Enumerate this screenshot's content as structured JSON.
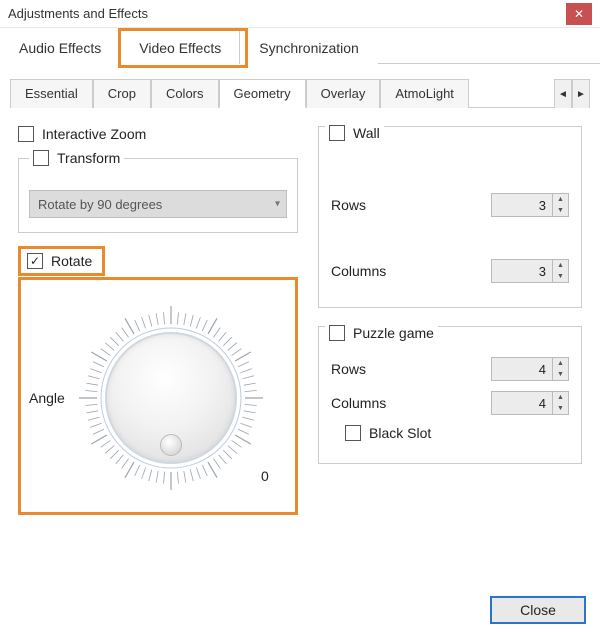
{
  "window": {
    "title": "Adjustments and Effects"
  },
  "main_tabs": {
    "audio": "Audio Effects",
    "video": "Video Effects",
    "sync": "Synchronization"
  },
  "sub_tabs": {
    "essential": "Essential",
    "crop": "Crop",
    "colors": "Colors",
    "geometry": "Geometry",
    "overlay": "Overlay",
    "atmolight": "AtmoLight"
  },
  "left": {
    "interactive_zoom": {
      "label": "Interactive Zoom",
      "checked": false
    },
    "transform": {
      "label": "Transform",
      "checked": false,
      "dropdown_value": "Rotate by 90 degrees"
    },
    "rotate": {
      "label": "Rotate",
      "checked": true,
      "angle_label": "Angle",
      "zero_label": "0"
    }
  },
  "right": {
    "wall": {
      "label": "Wall",
      "checked": false,
      "rows_label": "Rows",
      "rows_value": "3",
      "cols_label": "Columns",
      "cols_value": "3"
    },
    "puzzle": {
      "label": "Puzzle game",
      "checked": false,
      "rows_label": "Rows",
      "rows_value": "4",
      "cols_label": "Columns",
      "cols_value": "4",
      "black_slot_label": "Black Slot",
      "black_slot_checked": false
    }
  },
  "footer": {
    "close": "Close"
  }
}
